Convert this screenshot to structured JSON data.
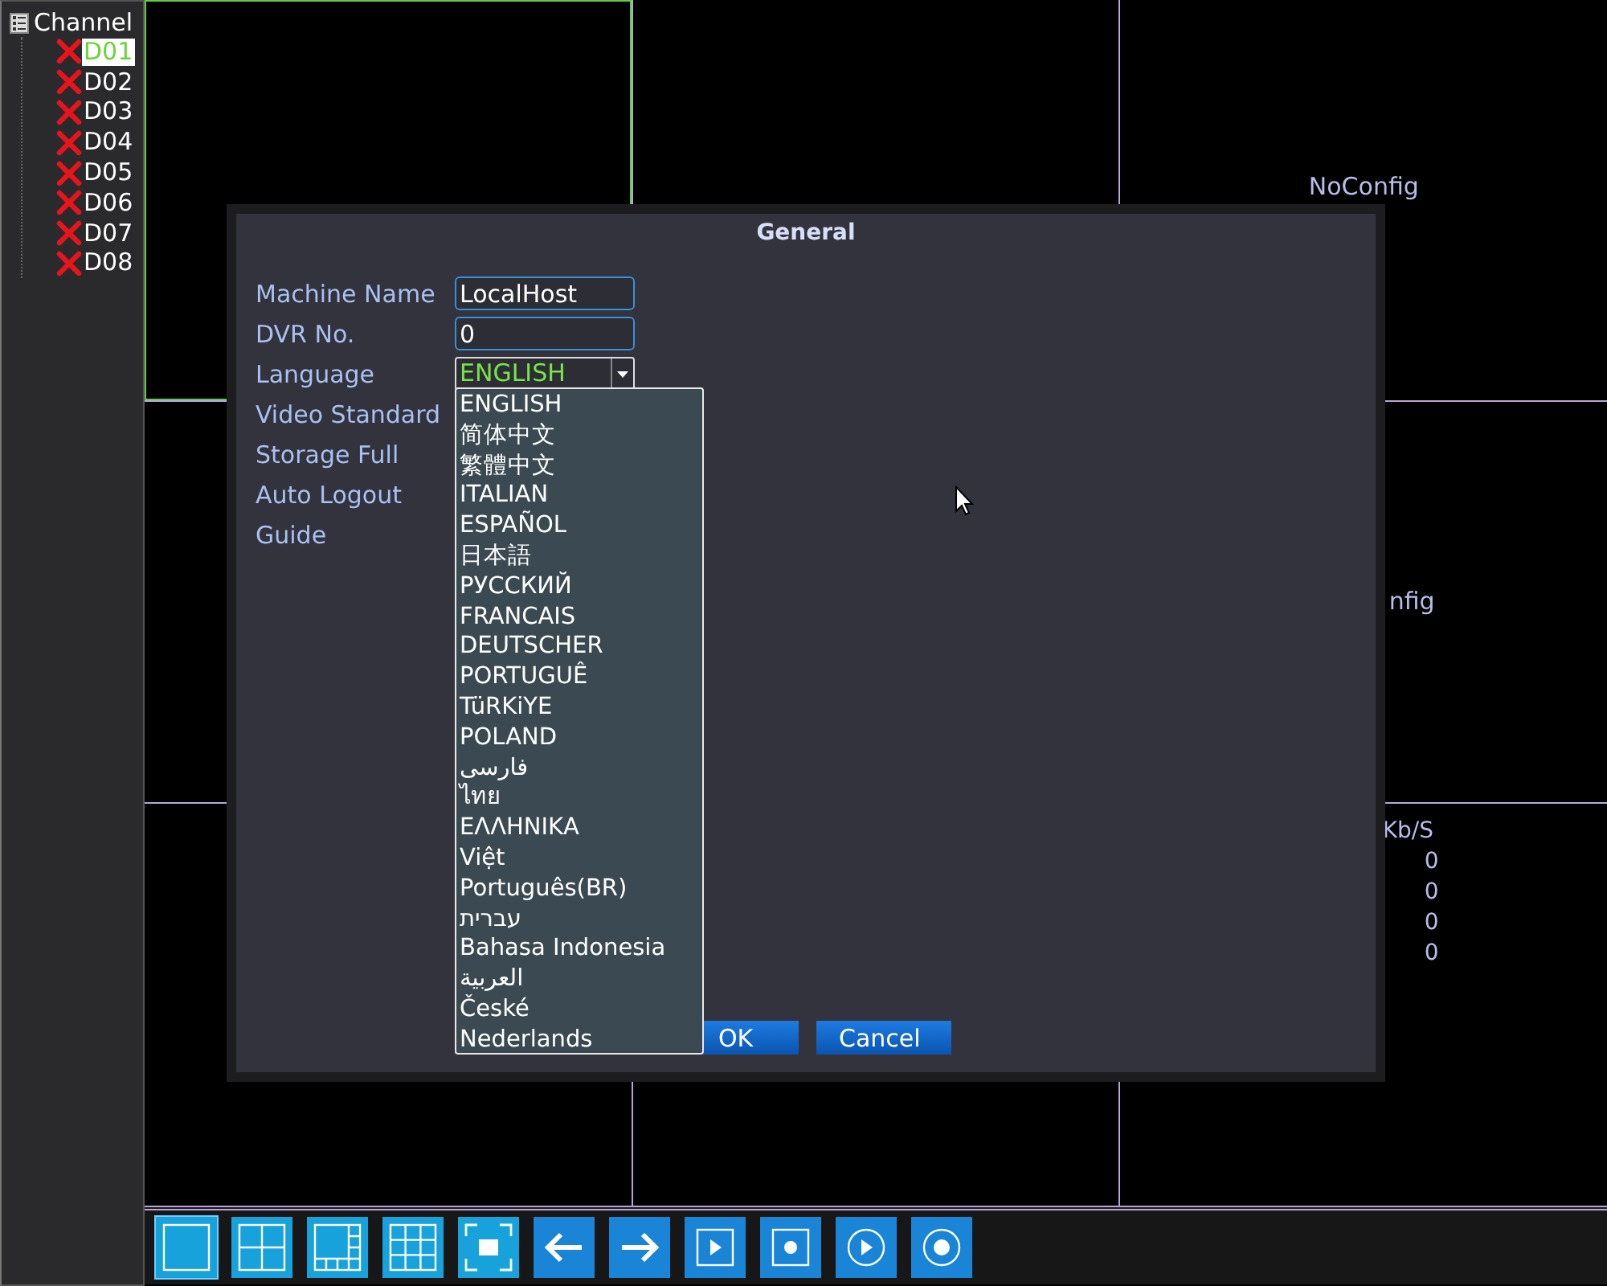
{
  "sidebar": {
    "title": "Channel",
    "channels": [
      {
        "label": "D01",
        "selected": true
      },
      {
        "label": "D02",
        "selected": false
      },
      {
        "label": "D03",
        "selected": false
      },
      {
        "label": "D04",
        "selected": false
      },
      {
        "label": "D05",
        "selected": false
      },
      {
        "label": "D06",
        "selected": false
      },
      {
        "label": "D07",
        "selected": false
      },
      {
        "label": "D08",
        "selected": false
      }
    ]
  },
  "video_grid": {
    "cells": [
      {
        "kind": "empty",
        "selected": true
      },
      {
        "kind": "empty",
        "selected": false
      },
      {
        "kind": "label",
        "text": "NoConfig",
        "selected": false
      },
      {
        "kind": "empty",
        "selected": false
      },
      {
        "kind": "empty"
      },
      {
        "kind": "clipped",
        "text": "nfig",
        "selected": false
      },
      {
        "kind": "empty",
        "selected": false
      },
      {
        "kind": "empty",
        "selected": false
      },
      {
        "kind": "stats",
        "header": "Kb/S",
        "values": [
          "0",
          "0",
          "0",
          "0"
        ],
        "selected": false
      }
    ]
  },
  "dialog": {
    "title": "General",
    "fields": [
      {
        "label": "Machine Name",
        "kind": "text",
        "value": "LocalHost"
      },
      {
        "label": "DVR No.",
        "kind": "text",
        "value": "0"
      },
      {
        "label": "Language",
        "kind": "select",
        "value": "ENGLISH"
      },
      {
        "label": "Video Standard",
        "kind": "hidden"
      },
      {
        "label": "Storage Full",
        "kind": "hidden"
      },
      {
        "label": "Auto Logout",
        "kind": "hidden"
      },
      {
        "label": "Guide",
        "kind": "hidden"
      }
    ],
    "language_options": [
      {
        "label": "ENGLISH",
        "selected": false
      },
      {
        "label": "简体中文",
        "selected": false
      },
      {
        "label": "繁體中文",
        "selected": false
      },
      {
        "label": "ITALIAN",
        "selected": false
      },
      {
        "label": "ESPAÑOL",
        "selected": false
      },
      {
        "label": "日本語",
        "selected": false
      },
      {
        "label": "РУССКИЙ",
        "selected": false
      },
      {
        "label": "FRANCAIS",
        "selected": false
      },
      {
        "label": "DEUTSCHER",
        "selected": false
      },
      {
        "label": "PORTUGUÊ",
        "selected": false
      },
      {
        "label": "TüRKiYE",
        "selected": false
      },
      {
        "label": "POLAND",
        "selected": false
      },
      {
        "label": "فارسی",
        "selected": false
      },
      {
        "label": "ไทย",
        "selected": false
      },
      {
        "label": "ΕΛΛΗΝΙΚΑ",
        "selected": false
      },
      {
        "label": "Việt",
        "selected": false
      },
      {
        "label": "Português(BR)",
        "selected": false
      },
      {
        "label": "עברית",
        "selected": false
      },
      {
        "label": "Bahasa Indonesia",
        "selected": false
      },
      {
        "label": "العربية",
        "selected": false
      },
      {
        "label": "České",
        "selected": false
      },
      {
        "label": "Nederlands",
        "selected": false
      }
    ],
    "buttons": [
      {
        "label": "OK"
      },
      {
        "label": "Cancel"
      }
    ]
  },
  "toolbar": [
    {
      "kind": "single",
      "selected": true
    },
    {
      "kind": "quad",
      "selected": false
    },
    {
      "kind": "split8",
      "selected": false
    },
    {
      "kind": "nine",
      "selected": false
    },
    {
      "kind": "fullscreen",
      "selected": false
    },
    {
      "kind": "prev",
      "selected": false
    },
    {
      "kind": "next",
      "selected": false
    },
    {
      "kind": "play-square",
      "selected": false
    },
    {
      "kind": "record-square",
      "selected": false
    },
    {
      "kind": "play-circle",
      "selected": false
    },
    {
      "kind": "record-circle",
      "selected": false
    }
  ]
}
